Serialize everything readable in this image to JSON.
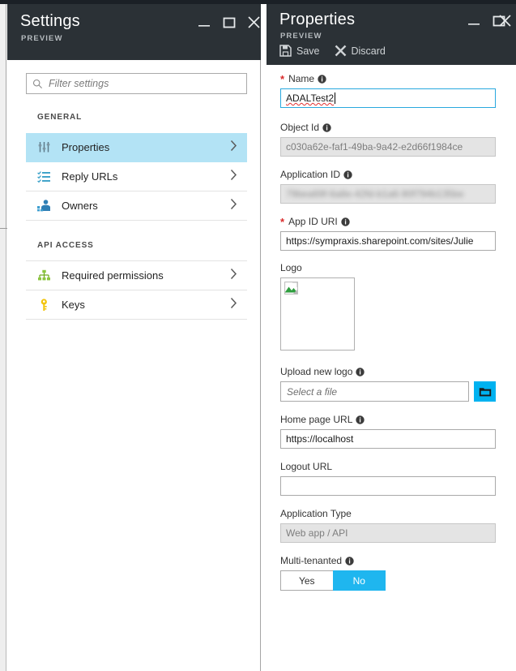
{
  "settings_blade": {
    "title": "Settings",
    "preview_label": "PREVIEW",
    "window_controls": [
      {
        "name": "minimize",
        "glyph": "minimize-icon"
      },
      {
        "name": "maximize",
        "glyph": "maximize-icon"
      },
      {
        "name": "close",
        "glyph": "close-icon"
      }
    ],
    "filter": {
      "placeholder": "Filter settings",
      "value": "",
      "icon": "search-icon"
    },
    "groups": [
      {
        "header": "GENERAL",
        "items": [
          {
            "label": "Properties",
            "icon": "sliders-icon",
            "selected": true
          },
          {
            "label": "Reply URLs",
            "icon": "checklist-icon",
            "selected": false
          },
          {
            "label": "Owners",
            "icon": "people-icon",
            "selected": false
          }
        ]
      },
      {
        "header": "API ACCESS",
        "items": [
          {
            "label": "Required permissions",
            "icon": "hierarchy-icon",
            "selected": false
          },
          {
            "label": "Keys",
            "icon": "key-icon",
            "selected": false
          }
        ]
      }
    ]
  },
  "properties_blade": {
    "title": "Properties",
    "preview_label": "PREVIEW",
    "window_controls": [
      {
        "name": "minimize",
        "glyph": "minimize-icon"
      },
      {
        "name": "maximize",
        "glyph": "maximize-icon"
      },
      {
        "name": "close",
        "glyph": "close-icon"
      }
    ],
    "commands": [
      {
        "label": "Save",
        "icon": "save-icon"
      },
      {
        "label": "Discard",
        "icon": "discard-icon"
      }
    ],
    "fields": {
      "name": {
        "label": "Name",
        "required": true,
        "has_info": true,
        "value": "ADALTest2",
        "focused": true,
        "spellcheck_error": true
      },
      "object_id": {
        "label": "Object Id",
        "required": false,
        "has_info": true,
        "value": "c030a62e-faf1-49ba-9a42-e2d66f1984ce",
        "readonly": true
      },
      "application_id": {
        "label": "Application ID",
        "required": false,
        "has_info": true,
        "value": "79bea69f-6a8e-42fd-b1a6-90f794b135be",
        "readonly": true,
        "redacted": true
      },
      "app_id_uri": {
        "label": "App ID URI",
        "required": true,
        "has_info": true,
        "value": "https://sympraxis.sharepoint.com/sites/Julie"
      },
      "logo": {
        "label": "Logo",
        "required": false,
        "has_info": false,
        "image_state": "broken-image-icon"
      },
      "upload_new_logo": {
        "label": "Upload new logo",
        "required": false,
        "has_info": true,
        "placeholder": "Select a file",
        "value": "",
        "browse_icon": "folder-icon"
      },
      "home_page_url": {
        "label": "Home page URL",
        "required": false,
        "has_info": true,
        "value": "https://localhost"
      },
      "logout_url": {
        "label": "Logout URL",
        "required": false,
        "has_info": false,
        "value": ""
      },
      "application_type": {
        "label": "Application Type",
        "required": false,
        "has_info": false,
        "value": "Web app / API",
        "readonly": true
      },
      "multi_tenanted": {
        "label": "Multi-tenanted",
        "required": false,
        "has_info": true,
        "options": [
          "Yes",
          "No"
        ],
        "selected": "No"
      }
    }
  },
  "colors": {
    "header_bg": "#2b3136",
    "accent_cyan": "#00b2f0",
    "selected_nav": "#b3e3f5",
    "required_red": "#d92b2b",
    "toggle_on": "#1fb6ef"
  }
}
